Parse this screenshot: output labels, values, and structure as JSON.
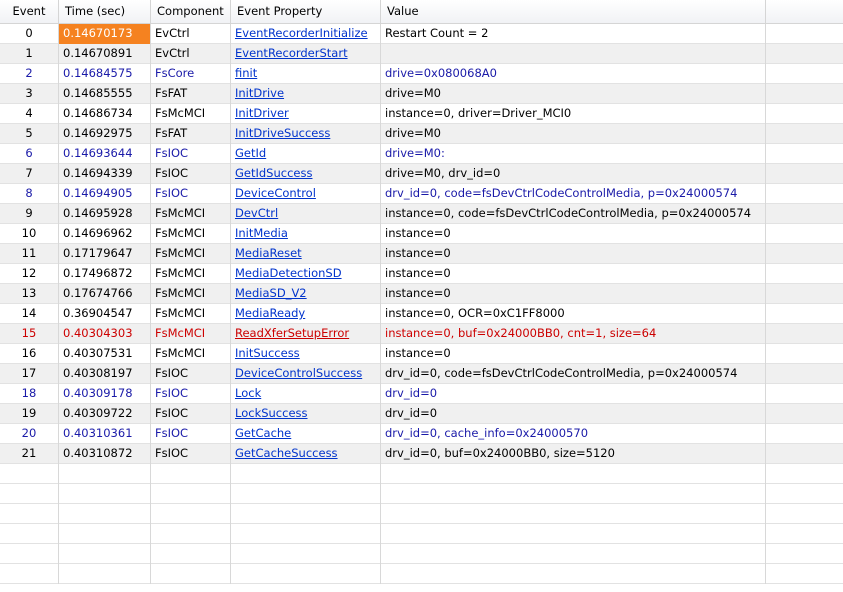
{
  "columns": [
    "Event",
    "Time (sec)",
    "Component",
    "Event Property",
    "Value"
  ],
  "rows": [
    {
      "event": "0",
      "time": "0.14670173",
      "component": "EvCtrl",
      "property": "EventRecorderInitialize",
      "value": "Restart Count = 2",
      "style": "normal"
    },
    {
      "event": "1",
      "time": "0.14670891",
      "component": "EvCtrl",
      "property": "EventRecorderStart",
      "value": "",
      "style": "normal"
    },
    {
      "event": "2",
      "time": "0.14684575",
      "component": "FsCore",
      "property": "finit",
      "value": "drive=0x080068A0",
      "style": "blue"
    },
    {
      "event": "3",
      "time": "0.14685555",
      "component": "FsFAT",
      "property": "InitDrive",
      "value": "drive=M0",
      "style": "normal"
    },
    {
      "event": "4",
      "time": "0.14686734",
      "component": "FsMcMCI",
      "property": "InitDriver",
      "value": "instance=0, driver=Driver_MCI0",
      "style": "normal"
    },
    {
      "event": "5",
      "time": "0.14692975",
      "component": "FsFAT",
      "property": "InitDriveSuccess",
      "value": "drive=M0",
      "style": "normal"
    },
    {
      "event": "6",
      "time": "0.14693644",
      "component": "FsIOC",
      "property": "GetId",
      "value": "drive=M0:",
      "style": "blue"
    },
    {
      "event": "7",
      "time": "0.14694339",
      "component": "FsIOC",
      "property": "GetIdSuccess",
      "value": "drive=M0, drv_id=0",
      "style": "normal"
    },
    {
      "event": "8",
      "time": "0.14694905",
      "component": "FsIOC",
      "property": "DeviceControl",
      "value": "drv_id=0, code=fsDevCtrlCodeControlMedia, p=0x24000574",
      "style": "blue"
    },
    {
      "event": "9",
      "time": "0.14695928",
      "component": "FsMcMCI",
      "property": "DevCtrl",
      "value": "instance=0, code=fsDevCtrlCodeControlMedia, p=0x24000574",
      "style": "normal"
    },
    {
      "event": "10",
      "time": "0.14696962",
      "component": "FsMcMCI",
      "property": "InitMedia",
      "value": "instance=0",
      "style": "normal"
    },
    {
      "event": "11",
      "time": "0.17179647",
      "component": "FsMcMCI",
      "property": "MediaReset",
      "value": "instance=0",
      "style": "normal"
    },
    {
      "event": "12",
      "time": "0.17496872",
      "component": "FsMcMCI",
      "property": "MediaDetectionSD",
      "value": "instance=0",
      "style": "normal"
    },
    {
      "event": "13",
      "time": "0.17674766",
      "component": "FsMcMCI",
      "property": "MediaSD_V2",
      "value": "instance=0",
      "style": "normal"
    },
    {
      "event": "14",
      "time": "0.36904547",
      "component": "FsMcMCI",
      "property": "MediaReady",
      "value": "instance=0, OCR=0xC1FF8000",
      "style": "normal"
    },
    {
      "event": "15",
      "time": "0.40304303",
      "component": "FsMcMCI",
      "property": "ReadXferSetupError",
      "value": "instance=0, buf=0x24000BB0, cnt=1, size=64",
      "style": "red"
    },
    {
      "event": "16",
      "time": "0.40307531",
      "component": "FsMcMCI",
      "property": "InitSuccess",
      "value": "instance=0",
      "style": "normal"
    },
    {
      "event": "17",
      "time": "0.40308197",
      "component": "FsIOC",
      "property": "DeviceControlSuccess",
      "value": "drv_id=0, code=fsDevCtrlCodeControlMedia, p=0x24000574",
      "style": "normal"
    },
    {
      "event": "18",
      "time": "0.40309178",
      "component": "FsIOC",
      "property": "Lock",
      "value": "drv_id=0",
      "style": "blue"
    },
    {
      "event": "19",
      "time": "0.40309722",
      "component": "FsIOC",
      "property": "LockSuccess",
      "value": "drv_id=0",
      "style": "normal"
    },
    {
      "event": "20",
      "time": "0.40310361",
      "component": "FsIOC",
      "property": "GetCache",
      "value": "drv_id=0, cache_info=0x24000570",
      "style": "blue"
    },
    {
      "event": "21",
      "time": "0.40310872",
      "component": "FsIOC",
      "property": "GetCacheSuccess",
      "value": "drv_id=0, buf=0x24000BB0, size=5120",
      "style": "normal"
    }
  ],
  "selected_cell": {
    "row": 0,
    "column": "time"
  },
  "colors": {
    "selection": "#f58220",
    "link": "#0033cc",
    "error": "#cc0000",
    "op_start": "#1a1aa8"
  }
}
